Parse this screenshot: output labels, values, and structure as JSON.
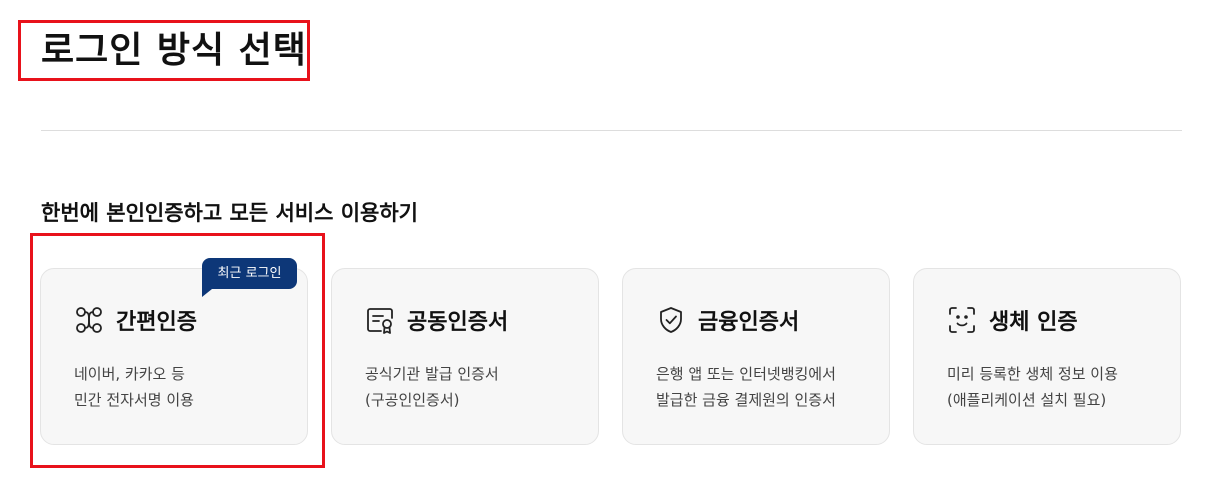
{
  "page": {
    "title": "로그인 방식 선택"
  },
  "section": {
    "title": "한번에 본인인증하고 모든 서비스 이용하기"
  },
  "badge": {
    "label": "최근 로그인"
  },
  "cards": [
    {
      "title": "간편인증",
      "icon": "link-nodes-icon",
      "desc": [
        "네이버, 카카오 등",
        "민간 전자서명 이용"
      ]
    },
    {
      "title": "공동인증서",
      "icon": "certificate-icon",
      "desc": [
        "공식기관 발급 인증서",
        "(구공인인증서)"
      ]
    },
    {
      "title": "금융인증서",
      "icon": "shield-check-icon",
      "desc": [
        "은행 앱 또는 인터넷뱅킹에서",
        "발급한 금융 결제원의 인증서"
      ]
    },
    {
      "title": "생체 인증",
      "icon": "face-scan-icon",
      "desc": [
        "미리 등록한 생체 정보 이용",
        "(애플리케이션 설치 필요)"
      ]
    }
  ],
  "colors": {
    "highlight": "#e8121b",
    "badge": "#0d3778",
    "card_bg": "#f7f7f7"
  }
}
